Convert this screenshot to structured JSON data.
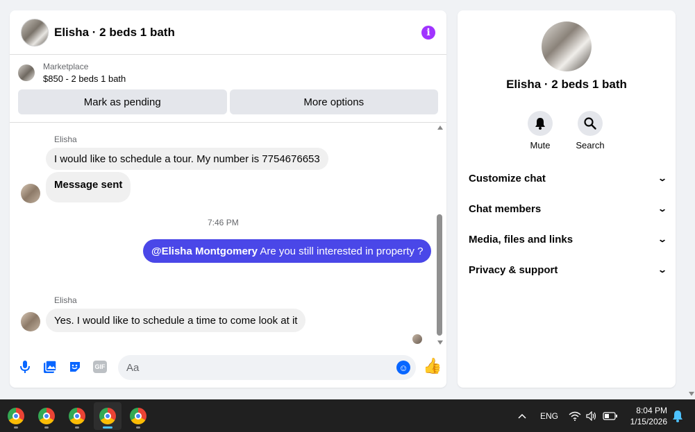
{
  "chat": {
    "title": "Elisha · 2 beds 1 bath",
    "marketplace_label": "Marketplace",
    "listing": "$850 - 2 beds 1 bath",
    "mark_pending_label": "Mark as pending",
    "more_options_label": "More options",
    "messages": {
      "sender1": "Elisha",
      "msg1": "I would like to schedule a tour. My number is 7754676653",
      "msg2": "Message sent",
      "timestamp": "7:46 PM",
      "out_mention": "@Elisha Montgomery",
      "out_text": " Are you still interested in property ?",
      "sender2": "Elisha",
      "msg3": "Yes. I would like to schedule a time to come look at it"
    },
    "composer_placeholder": "Aa",
    "gif_label": "GIF"
  },
  "side": {
    "title": "Elisha · 2 beds 1 bath",
    "mute_label": "Mute",
    "search_label": "Search",
    "sections": [
      "Customize chat",
      "Chat members",
      "Media, files and links",
      "Privacy & support"
    ]
  },
  "taskbar": {
    "language": "ENG",
    "time": "8:04 PM",
    "date": "1/15/2026"
  },
  "colors": {
    "accent": "#0866ff",
    "outgoing_bubble": "#4a47e8",
    "info_icon": "#a033ff"
  }
}
